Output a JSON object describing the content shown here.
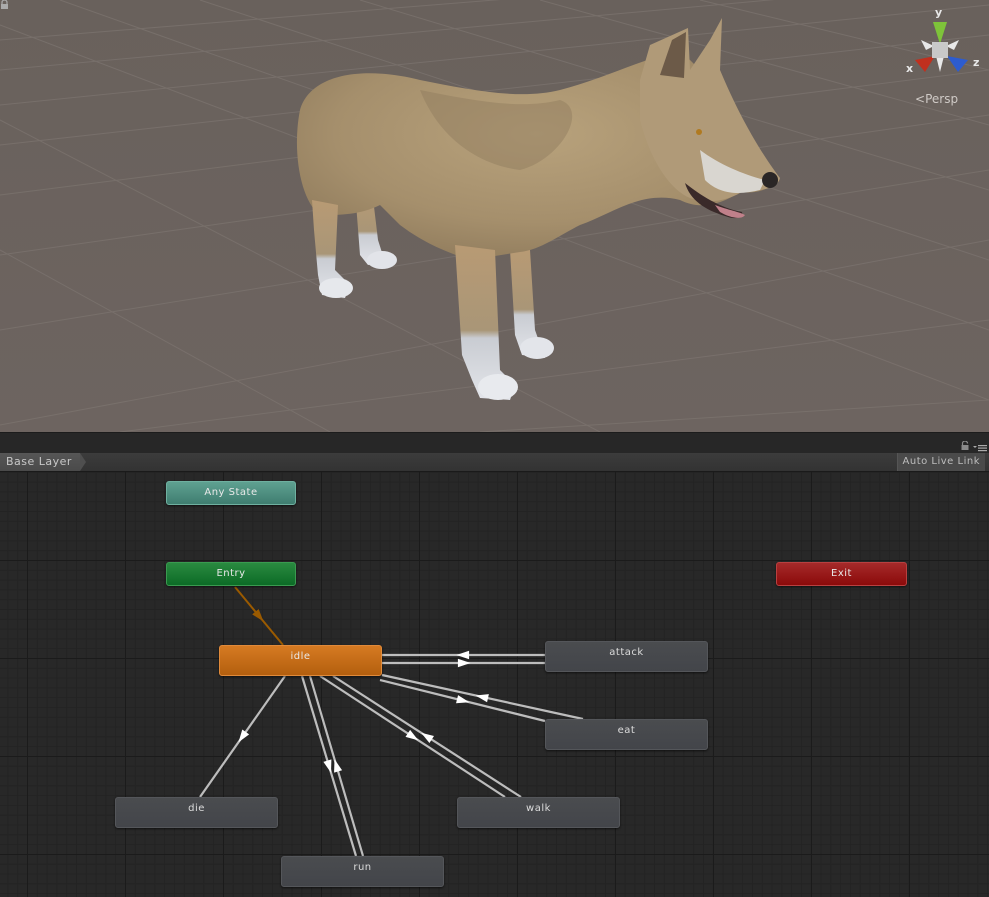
{
  "scene_view": {
    "gizmo": {
      "axis_labels": {
        "y": "y",
        "x": "x",
        "z": "z"
      },
      "colors": {
        "y": "#7ec33a",
        "x": "#c0301e",
        "z": "#2d5ccf"
      }
    },
    "projection_label": "Persp",
    "lock_icon": "lock-icon",
    "model": "wolf"
  },
  "animator": {
    "breadcrumb": "Base Layer",
    "auto_live_link_label": "Auto Live Link",
    "lock_icon": "lock-icon",
    "menu_icon": "menu-icon",
    "states": [
      {
        "id": "any",
        "label": "Any State",
        "kind": "any",
        "color": "#4f8f80"
      },
      {
        "id": "entry",
        "label": "Entry",
        "kind": "entry",
        "color": "#177a33"
      },
      {
        "id": "exit",
        "label": "Exit",
        "kind": "exit",
        "color": "#981a1a"
      },
      {
        "id": "idle",
        "label": "idle",
        "kind": "default",
        "color": "#c46c18"
      },
      {
        "id": "attack",
        "label": "attack",
        "kind": "state",
        "color": "#47494d"
      },
      {
        "id": "eat",
        "label": "eat",
        "kind": "state",
        "color": "#47494d"
      },
      {
        "id": "die",
        "label": "die",
        "kind": "state",
        "color": "#47494d"
      },
      {
        "id": "walk",
        "label": "walk",
        "kind": "state",
        "color": "#47494d"
      },
      {
        "id": "run",
        "label": "run",
        "kind": "state",
        "color": "#47494d"
      }
    ],
    "transitions": [
      {
        "from": "entry",
        "to": "idle",
        "color": "#9a5a00"
      },
      {
        "from": "attack",
        "to": "idle"
      },
      {
        "from": "idle",
        "to": "attack"
      },
      {
        "from": "eat",
        "to": "idle"
      },
      {
        "from": "idle",
        "to": "eat"
      },
      {
        "from": "idle",
        "to": "die"
      },
      {
        "from": "idle",
        "to": "run"
      },
      {
        "from": "run",
        "to": "idle"
      },
      {
        "from": "idle",
        "to": "walk"
      },
      {
        "from": "walk",
        "to": "idle"
      }
    ]
  }
}
